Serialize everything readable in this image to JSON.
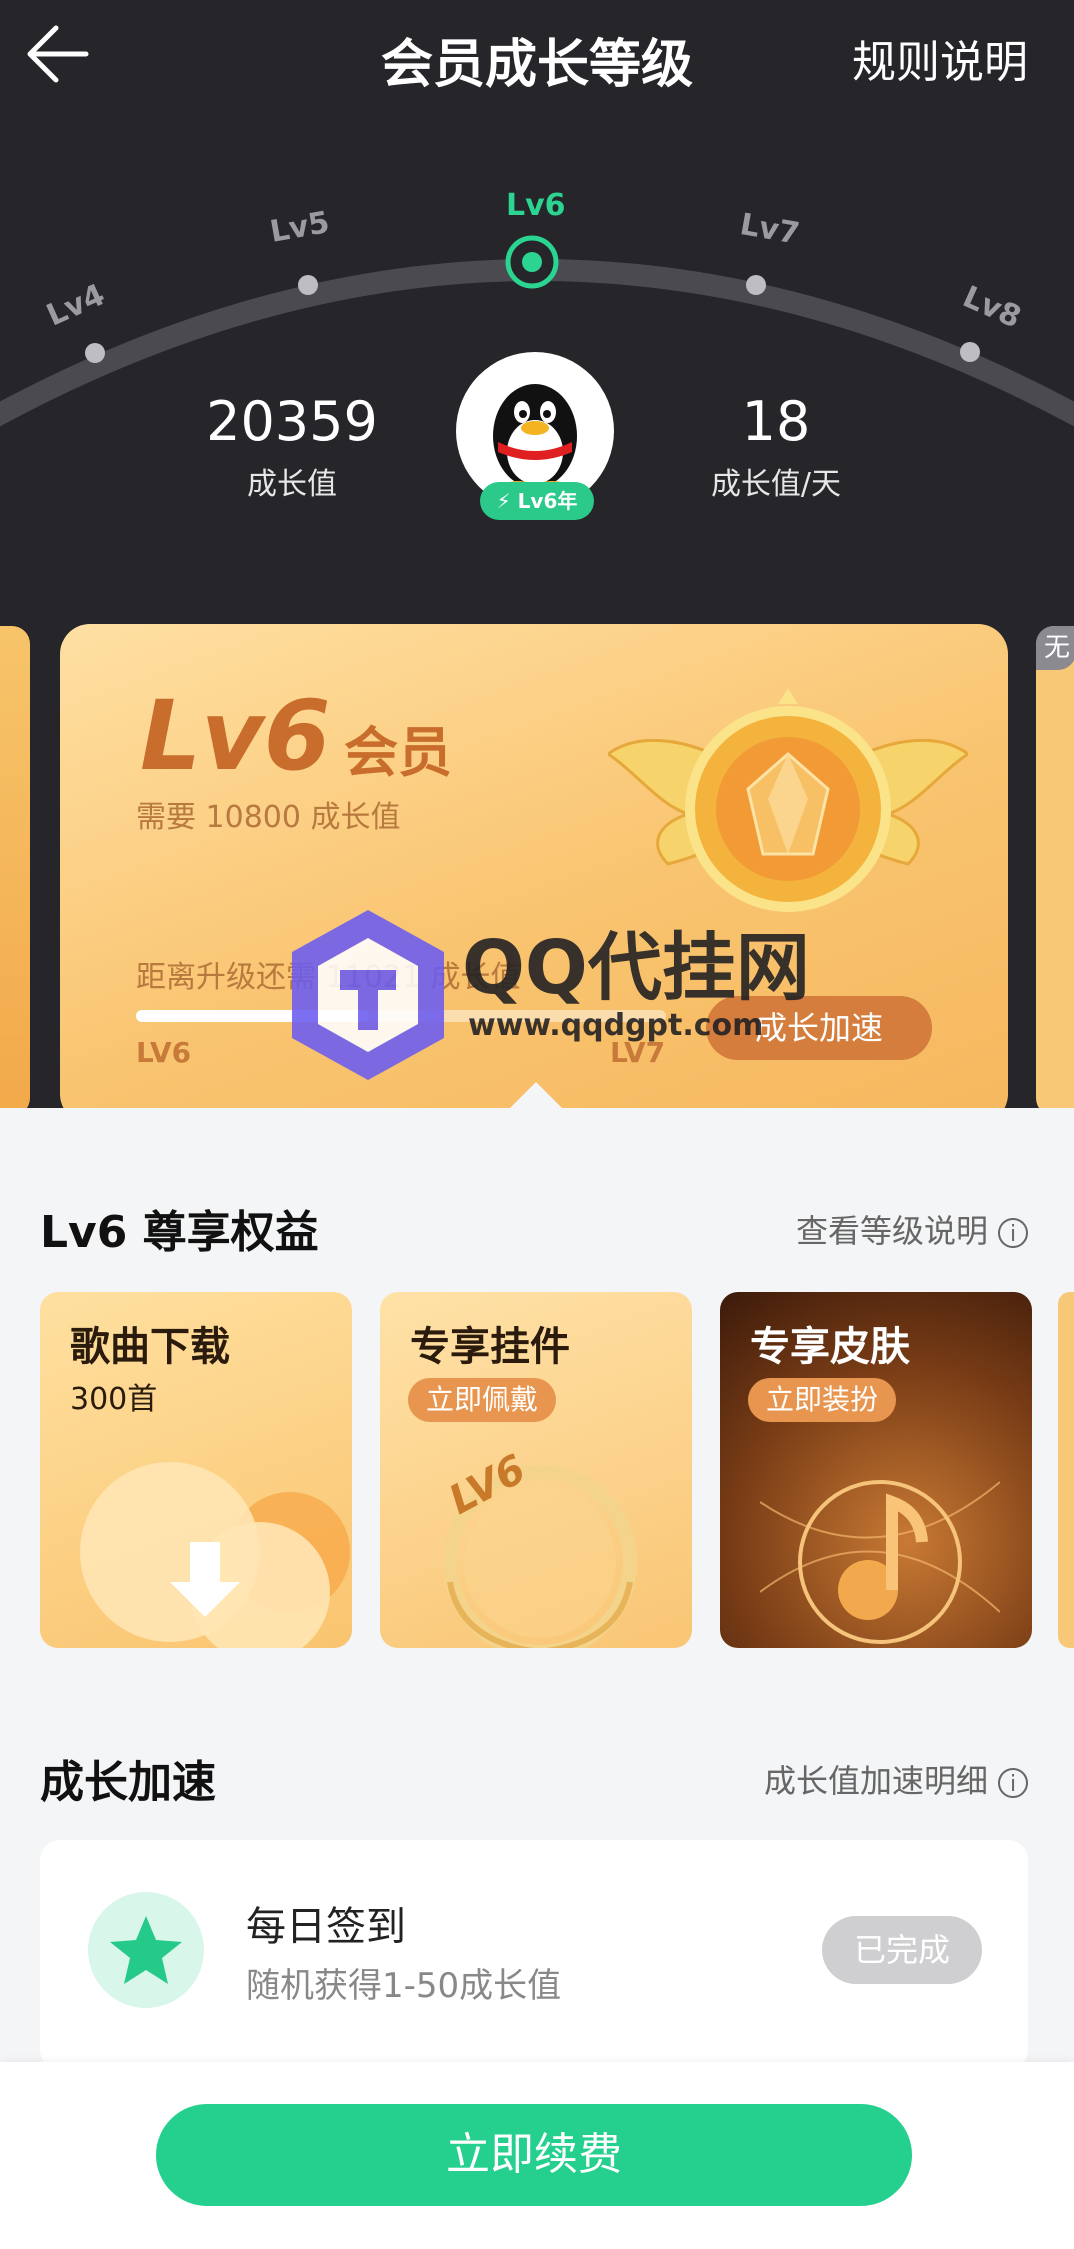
{
  "header": {
    "title": "会员成长等级",
    "rules": "规则说明"
  },
  "levels": {
    "items": [
      "Lv4",
      "Lv5",
      "Lv6",
      "Lv7",
      "Lv8"
    ],
    "current": "Lv6"
  },
  "stats": {
    "growth_value": "20359",
    "growth_label": "成长值",
    "per_day_value": "18",
    "per_day_label": "成长值/天"
  },
  "avatar": {
    "badge": "Lv6年"
  },
  "level_card": {
    "level": "Lv6",
    "member": "会员",
    "requirement": "需要 10800 成长值",
    "distance": "距离升级还需 11021 成长值",
    "progress": 0.44,
    "from_level": "LV6",
    "to_level": "LV7",
    "boost_button": "成长加速",
    "right_tag": "无"
  },
  "watermark": {
    "title": "QQ代挂网",
    "url": "www.qqdgpt.com"
  },
  "benefits": {
    "title": "Lv6 尊享权益",
    "link": "查看等级说明",
    "items": [
      {
        "title": "歌曲下载",
        "sub": "300首"
      },
      {
        "title": "专享挂件",
        "pill": "立即佩戴",
        "badge": "LV6"
      },
      {
        "title": "专享皮肤",
        "pill": "立即装扮"
      }
    ]
  },
  "boost": {
    "title": "成长加速",
    "link": "成长值加速明细",
    "tasks": [
      {
        "title": "每日签到",
        "desc": "随机获得1-50成长值",
        "button": "已完成"
      }
    ]
  },
  "footer": {
    "renew": "立即续费"
  },
  "colors": {
    "accent": "#25d08f",
    "dark_bg": "#25252a",
    "card_orange": "#f9c470",
    "level_text": "#c86d2b"
  }
}
